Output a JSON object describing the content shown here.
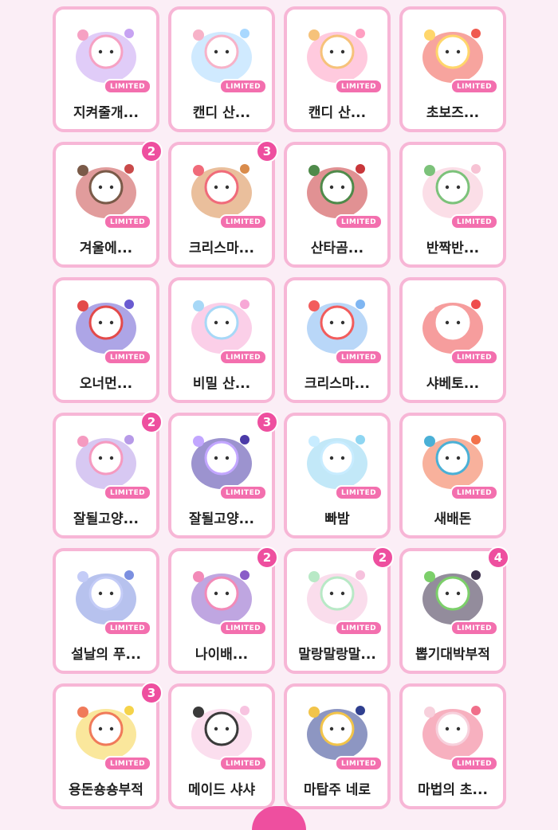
{
  "limited_label": "LIMITED",
  "colors": {
    "accent": "#ee4f9f",
    "card_border": "#f7b6d6",
    "background": "#fbeef6"
  },
  "items": [
    {
      "title": "지켜줄개...",
      "count": "",
      "art": "bunny-bouquet-icon",
      "c1": "#c7a3f2",
      "c2": "#f6a1c3"
    },
    {
      "title": "캔디 산...",
      "count": "",
      "art": "bunny-bow-icon",
      "c1": "#a9d8ff",
      "c2": "#f7b2c8"
    },
    {
      "title": "캔디 산...",
      "count": "",
      "art": "pink-blob-candy-icon",
      "c1": "#ff9fc2",
      "c2": "#f6c27a"
    },
    {
      "title": "초보즈...",
      "count": "",
      "art": "red-cat-food-icon",
      "c1": "#f05a4f",
      "c2": "#ffd66b"
    },
    {
      "title": "겨울에...",
      "count": "2",
      "art": "hat-dog-icon",
      "c1": "#c94a4a",
      "c2": "#7a5a48"
    },
    {
      "title": "크리스마...",
      "count": "3",
      "art": "gingerbread-house-icon",
      "c1": "#d98b4b",
      "c2": "#f06b7a"
    },
    {
      "title": "산타곰...",
      "count": "",
      "art": "santa-train-icon",
      "c1": "#c8363a",
      "c2": "#4f8a4a"
    },
    {
      "title": "반짝반...",
      "count": "",
      "art": "christmas-cat-icon",
      "c1": "#f7c3d4",
      "c2": "#7cc27a"
    },
    {
      "title": "오너먼...",
      "count": "",
      "art": "snow-globe-icon",
      "c1": "#6a5bd1",
      "c2": "#e34a4a"
    },
    {
      "title": "비밀 산...",
      "count": "",
      "art": "fairy-tree-icon",
      "c1": "#f7a7d6",
      "c2": "#a7d8f7"
    },
    {
      "title": "크리스마...",
      "count": "",
      "art": "penguin-snowman-icon",
      "c1": "#7fb6f2",
      "c2": "#f25c5c"
    },
    {
      "title": "샤베토...",
      "count": "",
      "art": "bunny-strawberry-bowl-icon",
      "c1": "#ef4d4d",
      "c2": "#ffffff"
    },
    {
      "title": "잘될고양...",
      "count": "2",
      "art": "purple-cat-flowers-icon",
      "c1": "#b79ae8",
      "c2": "#f59ac0"
    },
    {
      "title": "잘될고양...",
      "count": "3",
      "art": "cat-magic-book-icon",
      "c1": "#4b3aa8",
      "c2": "#c2a6ff"
    },
    {
      "title": "빠밤",
      "count": "",
      "art": "blue-ghost-2025-icon",
      "c1": "#8fd6f2",
      "c2": "#c8ecff"
    },
    {
      "title": "새배돈",
      "count": "",
      "art": "money-envelope-icon",
      "c1": "#f2714a",
      "c2": "#4ab0d6"
    },
    {
      "title": "설날의 푸...",
      "count": "",
      "art": "blue-hanbok-cat-icon",
      "c1": "#7b8fe0",
      "c2": "#c4ccf7"
    },
    {
      "title": "나이배...",
      "count": "2",
      "art": "purple-castle-icon",
      "c1": "#8a5cc8",
      "c2": "#f28ab8"
    },
    {
      "title": "말랑말랑말...",
      "count": "2",
      "art": "pastel-blobs-icon",
      "c1": "#f6c1dd",
      "c2": "#b8e9c6"
    },
    {
      "title": "뽑기대박부적",
      "count": "4",
      "art": "black-cat-charm-icon",
      "c1": "#3a2e4a",
      "c2": "#7ccf6a"
    },
    {
      "title": "용돈숑숑부적",
      "count": "3",
      "art": "yellow-chick-charm-icon",
      "c1": "#f5d34a",
      "c2": "#f07a5a"
    },
    {
      "title": "메이드 샤샤",
      "count": "",
      "art": "maid-bunny-icon",
      "c1": "#f7c3e0",
      "c2": "#3a3a3a"
    },
    {
      "title": "마탑주 네로",
      "count": "",
      "art": "wizard-black-cat-icon",
      "c1": "#2f3f8f",
      "c2": "#f2c44a"
    },
    {
      "title": "마법의 초...",
      "count": "",
      "art": "magic-strawberry-icon",
      "c1": "#f06f8a",
      "c2": "#f7d0dc"
    }
  ]
}
